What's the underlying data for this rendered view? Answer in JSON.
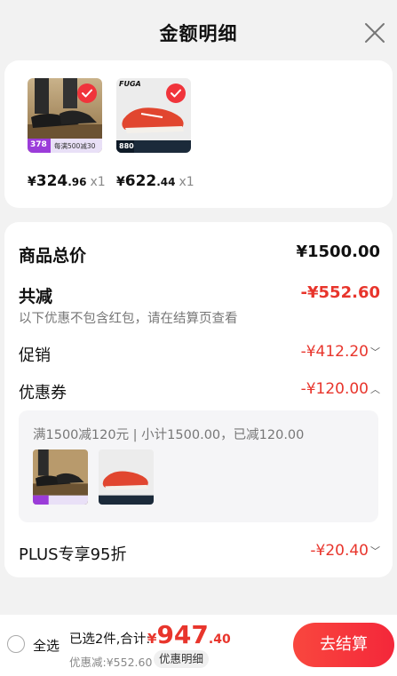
{
  "header": {
    "title": "金额明细"
  },
  "products": [
    {
      "name": "black-shoe",
      "price_int": "324",
      "price_dec": ".96",
      "currency": "¥",
      "qty": "x1",
      "badge_price": "378",
      "badge_text": "每满500减30"
    },
    {
      "name": "red-shoe",
      "price_int": "622",
      "price_dec": ".44",
      "currency": "¥",
      "qty": "x1",
      "brand": "FUGA",
      "badge_price": "880"
    }
  ],
  "detail": {
    "subtotal_label": "商品总价",
    "subtotal_value": "¥1500.00",
    "reduction_label": "共减",
    "reduction_value": "-¥552.60",
    "reduction_note": "以下优惠不包含红包，请在结算页查看",
    "promo_label": "促销",
    "promo_value": "-¥412.20",
    "coupon_label": "优惠券",
    "coupon_value": "-¥120.00",
    "coupon_desc": "满1500减120元 | 小计1500.00，已减120.00",
    "plus_label": "PLUS专享95折",
    "plus_value": "-¥20.40"
  },
  "bottom": {
    "select_all": "全选",
    "summary": "已选2件,合计:",
    "total_currency": "¥",
    "total_int": "947",
    "total_dec": ".40",
    "discount": "优惠减:¥552.60",
    "detail_button": "优惠明细",
    "checkout_button": "去结算"
  },
  "colors": {
    "accent_red": "#e8352c",
    "check_red": "#f0343b"
  }
}
